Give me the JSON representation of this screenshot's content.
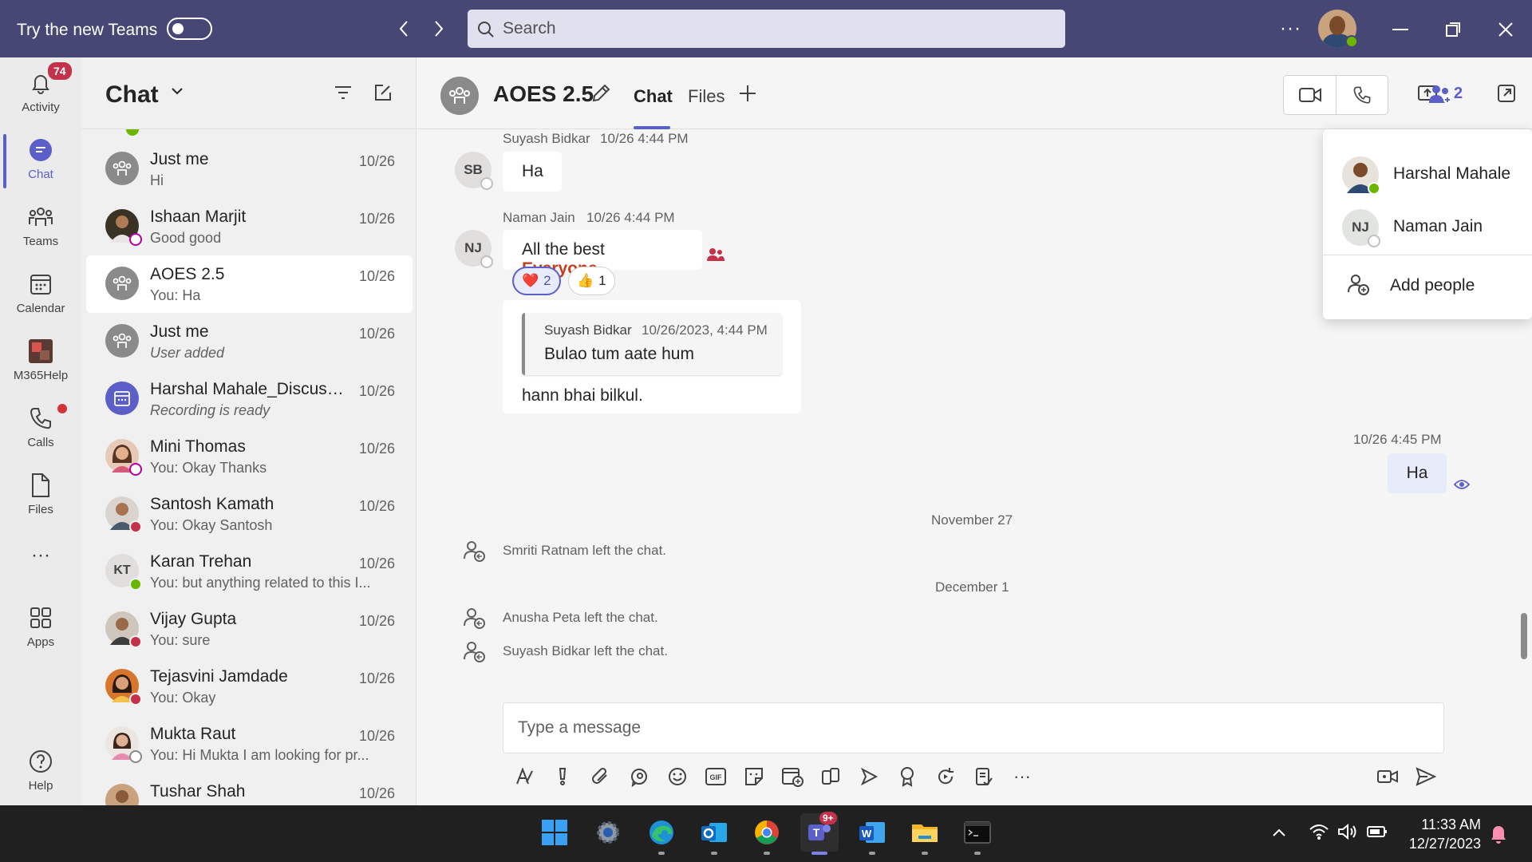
{
  "titlebar": {
    "try_label": "Try the new Teams",
    "search_placeholder": "Search",
    "more": "···"
  },
  "rail": {
    "activity": {
      "label": "Activity",
      "badge": "74"
    },
    "chat": "Chat",
    "teams": "Teams",
    "calendar": "Calendar",
    "m365": "M365Help",
    "calls": "Calls",
    "files": "Files",
    "more": "···",
    "apps": "Apps",
    "help": "Help"
  },
  "chat_list": {
    "title": "Chat",
    "items": [
      {
        "name": "Just me",
        "preview": "Hi",
        "date": "10/26"
      },
      {
        "name": "Ishaan Marjit",
        "preview": "Good good",
        "date": "10/26"
      },
      {
        "name": "AOES 2.5",
        "preview": "You: Ha",
        "date": "10/26"
      },
      {
        "name": "Just me",
        "preview": "User added",
        "date": "10/26"
      },
      {
        "name": "Harshal Mahale_Discussi...",
        "preview": "Recording is ready",
        "date": "10/26"
      },
      {
        "name": "Mini Thomas",
        "preview": "You: Okay Thanks",
        "date": "10/26"
      },
      {
        "name": "Santosh Kamath",
        "preview": "You: Okay Santosh",
        "date": "10/26"
      },
      {
        "name": "Karan Trehan",
        "preview": "You: but anything related to this I...",
        "date": "10/26",
        "initials": "KT"
      },
      {
        "name": "Vijay Gupta",
        "preview": "You: sure",
        "date": "10/26"
      },
      {
        "name": "Tejasvini Jamdade",
        "preview": "You: Okay",
        "date": "10/26"
      },
      {
        "name": "Mukta Raut",
        "preview": "You: Hi Mukta I am looking for pr...",
        "date": "10/26"
      },
      {
        "name": "Tushar Shah",
        "preview": "",
        "date": "10/26"
      }
    ]
  },
  "conversation": {
    "title": "AOES 2.5",
    "tabs": [
      "Chat",
      "Files"
    ],
    "people_count": "2",
    "messages": [
      {
        "sender": "Suyash Bidkar",
        "time": "10/26 4:44 PM",
        "initials": "SB",
        "text": "Ha"
      },
      {
        "sender": "Naman Jain",
        "time": "10/26 4:44 PM",
        "initials": "NJ",
        "text": "All the best ",
        "mention": "Everyone",
        "reactions": [
          {
            "emoji": "❤️",
            "count": "2"
          },
          {
            "emoji": "👍",
            "count": "1"
          }
        ]
      },
      {
        "quote_sender": "Suyash Bidkar",
        "quote_time": "10/26/2023, 4:44 PM",
        "quote_text": "Bulao tum aate hum",
        "text": "hann bhai bilkul."
      },
      {
        "time": "10/26 4:45 PM",
        "text": "Ha"
      }
    ],
    "date_nov": "November 27",
    "sys_1": "Smriti Ratnam left the chat.",
    "date_dec": "December 1",
    "sys_2": "Anusha Peta left the chat.",
    "sys_3": "Suyash Bidkar left the chat.",
    "compose_placeholder": "Type a message"
  },
  "participants": {
    "people": [
      {
        "name": "Harshal Mahale"
      },
      {
        "name": "Naman Jain",
        "initials": "NJ"
      }
    ],
    "add_label": "Add people"
  },
  "taskbar": {
    "time": "11:33 AM",
    "date": "12/27/2023",
    "teams_badge": "9+"
  },
  "colors": {
    "titlebar": "#464775",
    "accent": "#5b5fc7",
    "mention": "#c43e1c",
    "available": "#6bb700",
    "busy": "#c4314b"
  }
}
